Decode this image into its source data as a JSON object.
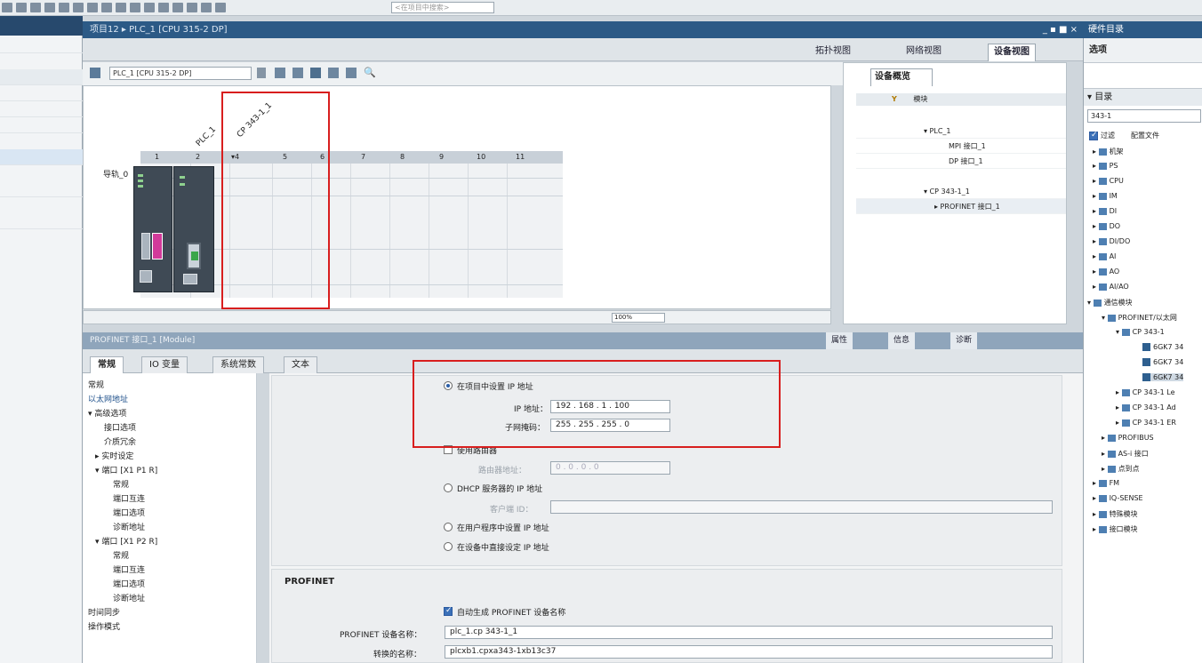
{
  "toolbar": {
    "search_placeholder": "<在项目中搜索>"
  },
  "main": {
    "title": "项目12 ▸ PLC_1 [CPU 315-2 DP]",
    "window_controls": "_ ▪ ■ ×",
    "view_tabs": [
      "拓扑视图",
      "网络视图",
      "设备视图"
    ],
    "device_selector": "PLC_1 [CPU 315-2 DP]",
    "zoom": "100%"
  },
  "canvas": {
    "rail_label": "导轨_0",
    "slots": [
      "1",
      "2",
      "▾4",
      "5",
      "6",
      "7",
      "8",
      "9",
      "10",
      "11"
    ],
    "module_labels": [
      "PLC_1",
      "CP 343-1_1"
    ]
  },
  "overview": {
    "tab": "设备概览",
    "header": "模块",
    "rows": [
      "▾ PLC_1",
      "MPI 接口_1",
      "DP 接口_1",
      "▾ CP 343-1_1",
      "▸ PROFINET 接口_1"
    ]
  },
  "properties": {
    "title": "PROFINET 接口_1 [Module]",
    "right_tabs": [
      "属性",
      "信息",
      "诊断"
    ],
    "tabs": [
      "常规",
      "IO 变量",
      "系统常数",
      "文本"
    ],
    "nav": [
      "常规",
      "以太网地址",
      "▾ 高级选项",
      "接口选项",
      "介质冗余",
      "▸ 实时设定",
      "▾ 端口 [X1 P1 R]",
      "常规",
      "端口互连",
      "端口选项",
      "诊断地址",
      "▾ 端口 [X1 P2 R]",
      "常规",
      "端口互连",
      "端口选项",
      "诊断地址",
      "时间同步",
      "操作模式"
    ],
    "ip": {
      "set_in_project": "在项目中设置 IP 地址",
      "ip_label": "IP 地址：",
      "ip_value": "192 . 168 . 1 . 100",
      "mask_label": "子网掩码：",
      "mask_value": "255 . 255 . 255 . 0",
      "use_router": "使用路由器",
      "router_label": "路由器地址：",
      "router_value": "0 . 0 . 0 . 0",
      "dhcp": "DHCP 服务器的 IP 地址",
      "client_id_label": "客户端 ID：",
      "user_program": "在用户程序中设置 IP 地址",
      "device_direct": "在设备中直接设定 IP 地址"
    },
    "profinet": {
      "heading": "PROFINET",
      "auto_name": "自动生成 PROFINET 设备名称",
      "device_name_label": "PROFINET 设备名称：",
      "device_name_value": "plc_1.cp 343-1_1",
      "converted_label": "转换的名称：",
      "converted_value": "plcxb1.cpxa343-1xb13c37"
    }
  },
  "catalog": {
    "title": "硬件目录",
    "options": "选项",
    "directory": "▾ 目录",
    "search": "343-1",
    "filter": "过滤",
    "profile": "配置文件",
    "items": [
      "机架",
      "PS",
      "CPU",
      "IM",
      "DI",
      "DO",
      "DI/DO",
      "AI",
      "AO",
      "AI/AO",
      "通信模块",
      "PROFINET/以太网",
      "CP 343-1",
      "6GK7 34",
      "6GK7 34",
      "6GK7 34",
      "CP 343-1 Le",
      "CP 343-1 Ad",
      "CP 343-1 ER",
      "PROFIBUS",
      "AS-i 接口",
      "点到点",
      "FM",
      "IQ-SENSE",
      "特殊模块",
      "接口模块"
    ]
  }
}
